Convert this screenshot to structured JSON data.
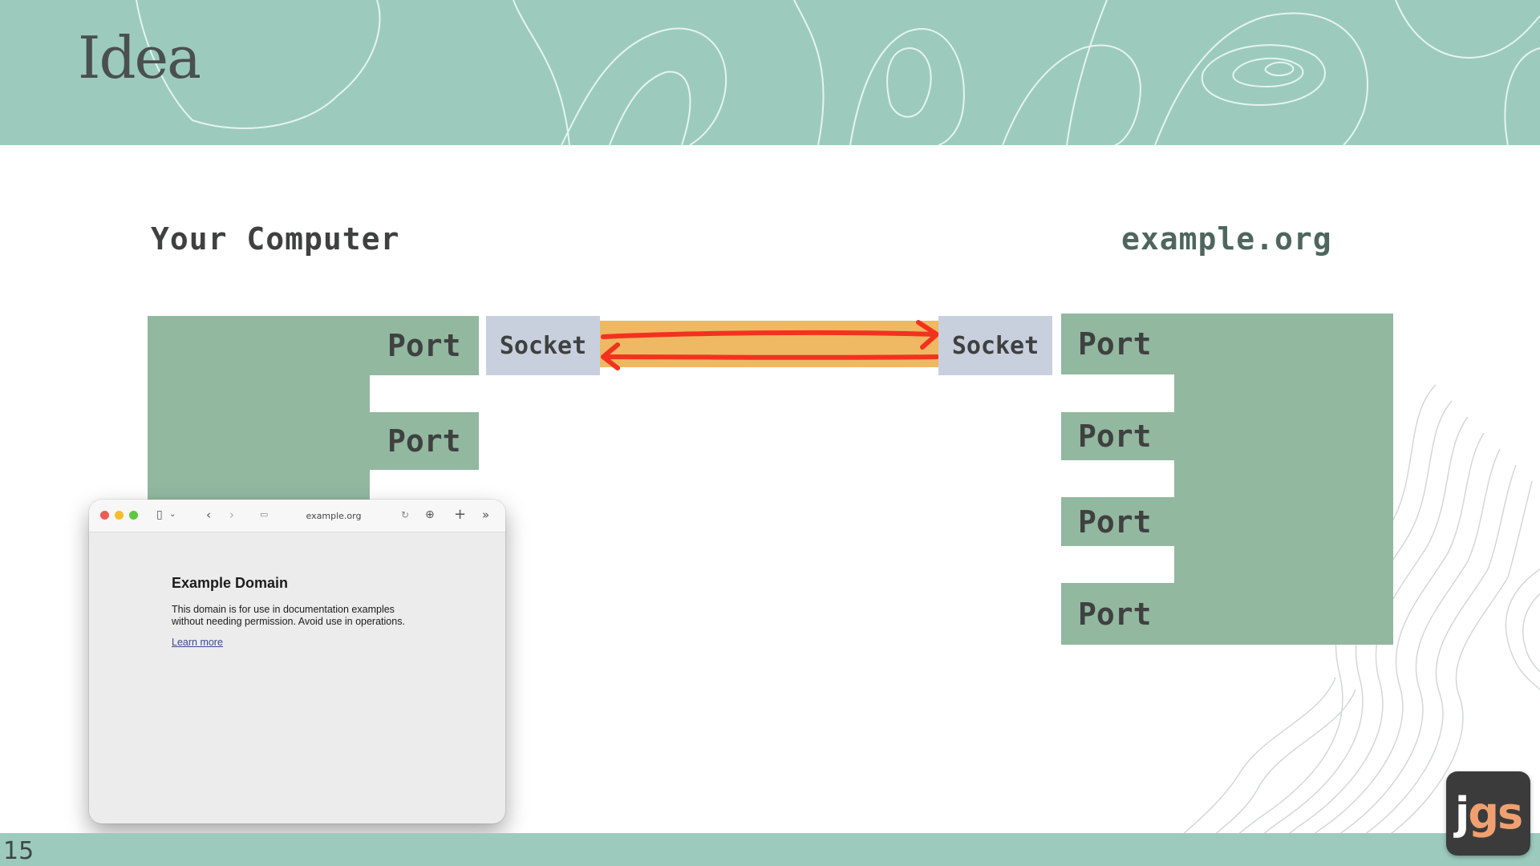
{
  "slide": {
    "title": "Idea",
    "page_number": "15"
  },
  "diagram": {
    "left_label": "Your Computer",
    "right_label": "example.org",
    "left_ports": [
      "Port",
      "Port"
    ],
    "right_ports": [
      "Port",
      "Port",
      "Port",
      "Port"
    ],
    "left_socket": "Socket",
    "right_socket": "Socket"
  },
  "browser": {
    "address": "example.org",
    "page_title": "Example Domain",
    "page_body": "This domain is for use in documentation examples without needing permission. Avoid use in operations.",
    "link_text": "Learn more"
  },
  "logo": {
    "letters": [
      "j",
      "g",
      "s"
    ],
    "colors": [
      "#ffffff",
      "#f0a070",
      "#f0a070"
    ]
  },
  "colors": {
    "header": "#9ccbbd",
    "block": "#92b8a0",
    "socket": "#c8d0de",
    "connection": "#efb863",
    "arrow": "#f2321e"
  }
}
